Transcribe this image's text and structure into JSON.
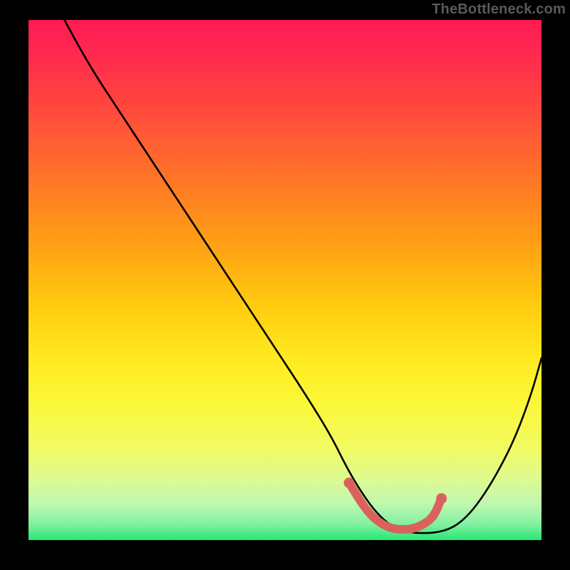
{
  "watermark": "TheBottleneck.com",
  "gradient": {
    "stops": [
      {
        "offset": 0,
        "color": "#ff1a53"
      },
      {
        "offset": 0.07,
        "color": "#ff2b4d"
      },
      {
        "offset": 0.15,
        "color": "#ff4240"
      },
      {
        "offset": 0.25,
        "color": "#ff6330"
      },
      {
        "offset": 0.35,
        "color": "#ff8420"
      },
      {
        "offset": 0.45,
        "color": "#ffa713"
      },
      {
        "offset": 0.55,
        "color": "#ffcc0f"
      },
      {
        "offset": 0.65,
        "color": "#ffe920"
      },
      {
        "offset": 0.74,
        "color": "#fbf83a"
      },
      {
        "offset": 0.82,
        "color": "#f2fb60"
      },
      {
        "offset": 0.88,
        "color": "#e0fa8e"
      },
      {
        "offset": 0.93,
        "color": "#c0f8b0"
      },
      {
        "offset": 0.97,
        "color": "#80f0a0"
      },
      {
        "offset": 1.0,
        "color": "#25e874"
      }
    ]
  },
  "chart_data": {
    "type": "line",
    "title": "",
    "xlabel": "",
    "ylabel": "",
    "xlim": [
      0,
      100
    ],
    "ylim": [
      0,
      100
    ],
    "series": [
      {
        "name": "bottleneck-curve",
        "color": "#000000",
        "x": [
          7,
          12,
          18,
          24,
          30,
          36,
          42,
          48,
          54,
          59,
          62,
          65,
          68,
          71,
          74,
          77,
          80,
          83,
          86,
          89,
          92,
          95,
          98,
          100
        ],
        "y": [
          100,
          91,
          82,
          73,
          64,
          55,
          46,
          37,
          28,
          20,
          14,
          9,
          5,
          2.5,
          1.5,
          1.3,
          1.5,
          2.5,
          5,
          9,
          14,
          20,
          28,
          35
        ]
      },
      {
        "name": "optimal-range-marker",
        "color": "#d9635c",
        "x": [
          62.5,
          65,
          67,
          69,
          71,
          73,
          75,
          77,
          79,
          80.5
        ],
        "y": [
          11,
          7,
          4.5,
          3,
          2.2,
          2,
          2.2,
          3,
          4.5,
          8
        ]
      }
    ],
    "annotations": []
  }
}
